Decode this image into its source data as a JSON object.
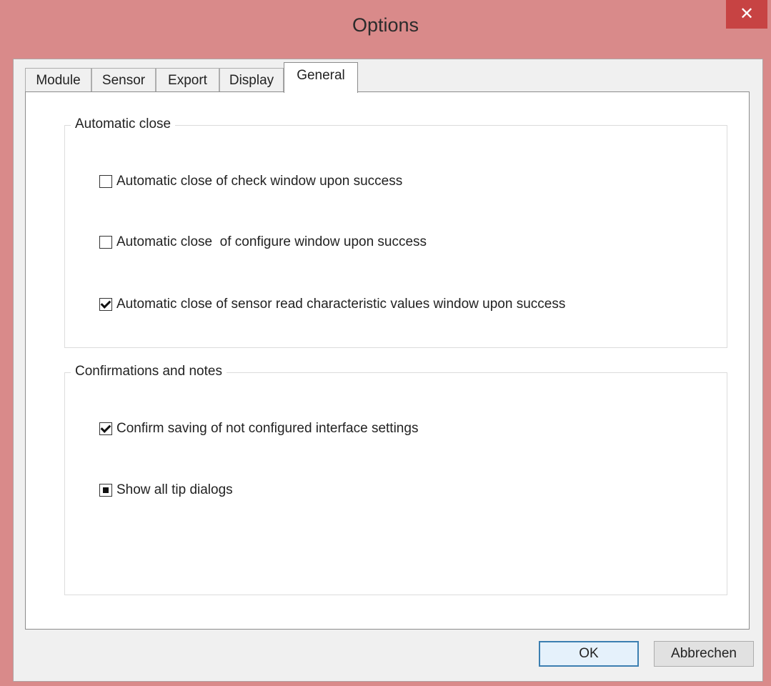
{
  "window": {
    "title": "Options",
    "close_glyph": "✕"
  },
  "tabs": [
    {
      "label": "Module"
    },
    {
      "label": "Sensor"
    },
    {
      "label": "Export"
    },
    {
      "label": "Display"
    },
    {
      "label": "General"
    }
  ],
  "active_tab": "General",
  "groups": {
    "automatic_close": {
      "label": "Automatic close",
      "items": [
        {
          "label": "Automatic close of check window upon success",
          "state": "unchecked"
        },
        {
          "label": "Automatic close  of configure window upon success",
          "state": "unchecked"
        },
        {
          "label": "Automatic close of sensor read characteristic values window upon success",
          "state": "checked"
        }
      ]
    },
    "confirmations": {
      "label": "Confirmations and notes",
      "items": [
        {
          "label": "Confirm saving of not configured interface settings",
          "state": "checked"
        },
        {
          "label": "Show all tip dialogs",
          "state": "indeterminate"
        }
      ]
    }
  },
  "buttons": {
    "ok": "OK",
    "cancel": "Abbrechen"
  },
  "colors": {
    "frame": "#d98a8a",
    "close": "#c74343",
    "default_button_border": "#3c7fb1"
  },
  "icons": {
    "close": "close-icon",
    "check": "checkmark-icon"
  }
}
